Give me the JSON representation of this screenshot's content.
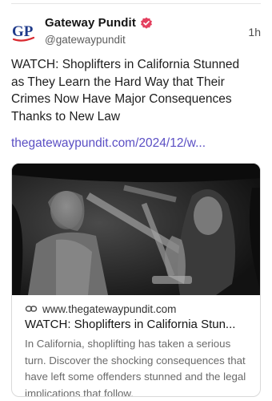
{
  "header": {
    "avatar_text": "GP",
    "display_name": "Gateway Pundit",
    "handle": "@gatewaypundit",
    "timestamp": "1h"
  },
  "post": {
    "text": "WATCH: Shoplifters in California Stunned as They Learn the Hard Way that Their Crimes Now Have Major Consequences Thanks to New Law",
    "link_text": "thegatewaypundit.com/2024/12/w..."
  },
  "card": {
    "domain": "www.thegatewaypundit.com",
    "title": "WATCH: Shoplifters in California Stun...",
    "description": "In California, shoplifting has taken a serious turn. Discover the shocking consequences that have left some offenders stunned and the legal implications that follow."
  },
  "icons": {
    "verified": "verified-badge-icon",
    "link": "link-icon"
  },
  "colors": {
    "link": "#5b4fc4",
    "verified": "#e4405f",
    "avatar_text": "#1f3a8a",
    "avatar_swoosh": "#d9282f"
  }
}
